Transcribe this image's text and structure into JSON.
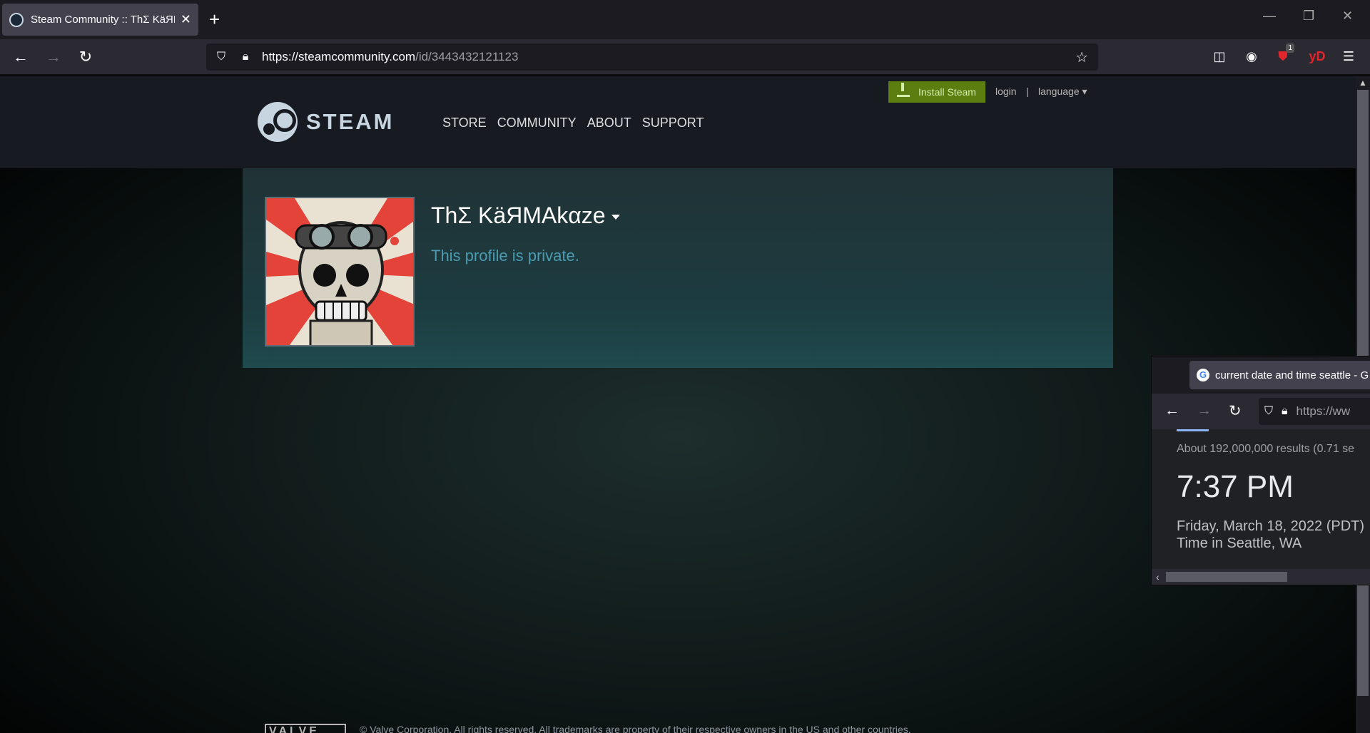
{
  "browser": {
    "tab_title": "Steam Community :: ThΣ KäЯM",
    "url_host": "https://steamcommunity.com",
    "url_path": "/id/3443432121123"
  },
  "steam": {
    "install_label": "Install Steam",
    "login_label": "login",
    "separator": "|",
    "language_label": "language",
    "logo_text": "STEAM",
    "nav": [
      "STORE",
      "COMMUNITY",
      "ABOUT",
      "SUPPORT"
    ],
    "profile_name": "ThΣ KäЯMAkαze",
    "private_text": "This profile is private.",
    "footer_logo": "VALVE",
    "footer_text": "© Valve Corporation. All rights reserved. All trademarks are property of their respective owners in the US and other countries."
  },
  "overlay": {
    "tab_title": "current date and time seattle - G",
    "url": "https://ww",
    "results": "About 192,000,000 results (0.71 se",
    "time": "7:37 PM",
    "date": "Friday, March 18, 2022 (PDT)",
    "location": "Time in Seattle, WA"
  },
  "colors": {
    "install_green": "#5c7e10",
    "private_blue": "#4b9bb1",
    "header_bg": "#171a21"
  }
}
